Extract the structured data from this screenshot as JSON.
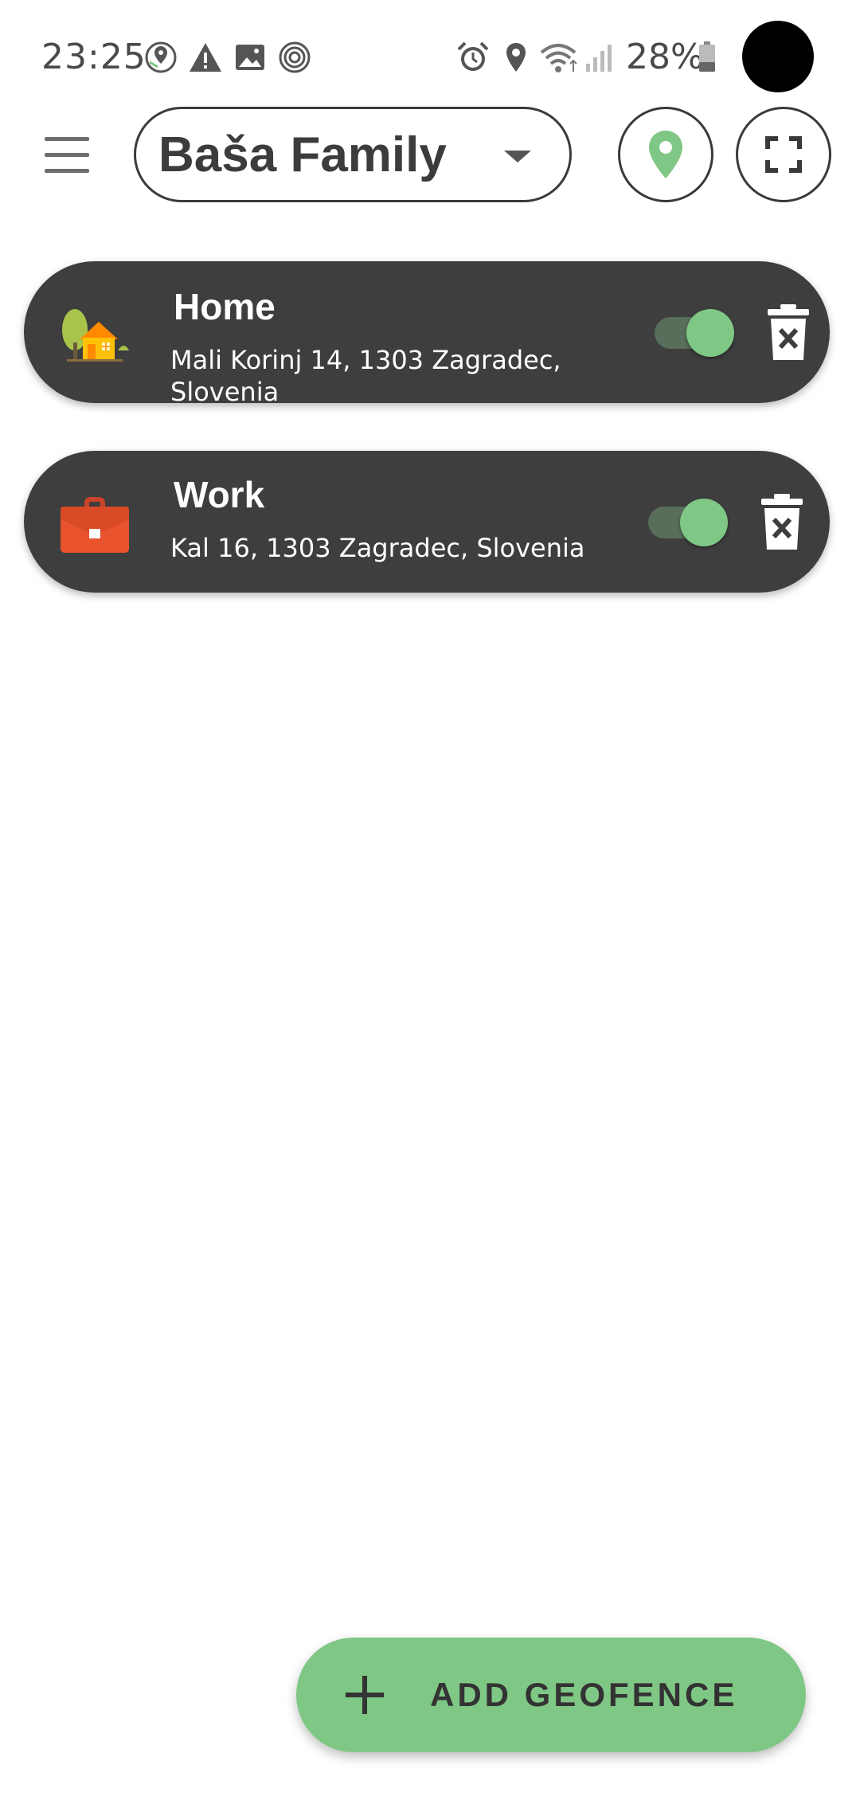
{
  "status_bar": {
    "time": "23:25",
    "battery_text": "28%",
    "icons": [
      "maps-notification-icon",
      "warning-icon",
      "image-icon",
      "fingerprint-icon",
      "alarm-icon",
      "location-icon",
      "wifi-icon",
      "signal-icon",
      "battery-icon"
    ]
  },
  "toolbar": {
    "group_name": "Baša Family",
    "icons": [
      "menu-icon",
      "chevron-down-icon",
      "map-pin-icon",
      "fullscreen-icon"
    ]
  },
  "geofences": [
    {
      "name": "Home",
      "address": "Mali Korinj 14, 1303 Zagradec, Slovenia",
      "icon": "house-icon",
      "enabled": true
    },
    {
      "name": "Work",
      "address": "Kal 16, 1303 Zagradec, Slovenia",
      "icon": "briefcase-icon",
      "enabled": true
    }
  ],
  "add_button": {
    "label": "ADD GEOFENCE",
    "icon": "plus-icon"
  },
  "colors": {
    "accent": "#7fc784",
    "card_background": "#3e3e3e",
    "toggle_track": "#586e5a",
    "text_dark": "#3c3c3c"
  }
}
